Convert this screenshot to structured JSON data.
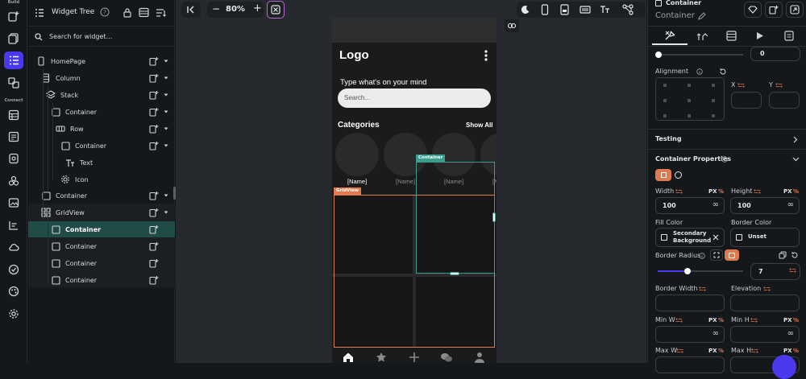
{
  "rail": {
    "build_label": "Build",
    "connect_label": "Connect"
  },
  "tree": {
    "title": "Widget Tree",
    "search_placeholder": "Search for widget...",
    "nodes": [
      {
        "label": "HomePage",
        "icon": "phone-icon"
      },
      {
        "label": "Column",
        "icon": "column-icon"
      },
      {
        "label": "Stack",
        "icon": "stack-icon"
      },
      {
        "label": "Container",
        "icon": "container-icon"
      },
      {
        "label": "Row",
        "icon": "row-icon"
      },
      {
        "label": "Container",
        "icon": "container-icon"
      },
      {
        "label": "Text",
        "icon": "text-icon"
      },
      {
        "label": "Icon",
        "icon": "gear-icon"
      },
      {
        "label": "Container",
        "icon": "container-icon"
      },
      {
        "label": "GridView",
        "icon": "grid-icon"
      },
      {
        "label": "Container",
        "icon": "container-icon"
      },
      {
        "label": "Container",
        "icon": "container-icon"
      },
      {
        "label": "Container",
        "icon": "container-icon"
      },
      {
        "label": "Container",
        "icon": "container-icon"
      }
    ]
  },
  "toolbar": {
    "zoom": "80%",
    "zoom_out": "−",
    "zoom_in": "+"
  },
  "phone": {
    "logo": "Logo",
    "prompt": "Type what's on your mind",
    "search_placeholder": "Search...",
    "categories_title": "Categories",
    "show_all": "Show All",
    "item_names": [
      "[Name]",
      "[Name]",
      "[Name]",
      "[N"
    ],
    "container_tag": "Container",
    "gridview_tag": "GridView"
  },
  "panel": {
    "widget_type": "Container",
    "widget_name": "Container",
    "slider_value": "0",
    "alignment_label": "Alignment",
    "x_label": "X",
    "y_label": "Y",
    "testing_label": "Testing",
    "props_title": "Container Properties",
    "width_label": "Width",
    "height_label": "Height",
    "unit_px": "PX",
    "unit_pct": "%",
    "width_value": "100",
    "height_value": "100",
    "infinity": "∞",
    "fill_color_label": "Fill Color",
    "border_color_label": "Border Color",
    "fill_color_value": "Secondary Background",
    "border_color_value": "Unset",
    "border_radius_label": "Border Radius",
    "border_radius_value": "7",
    "border_radius_fill": 0.35,
    "border_width_label": "Border Width",
    "elevation_label": "Elevation",
    "min_w_label": "Min W",
    "min_h_label": "Min H",
    "max_w_label": "Max W",
    "max_h_label": "Max H"
  },
  "colors": {
    "accent": "#4b39ef",
    "selection": "#214b47",
    "orange": "#e07a4f",
    "teal": "#3a9e8e"
  }
}
